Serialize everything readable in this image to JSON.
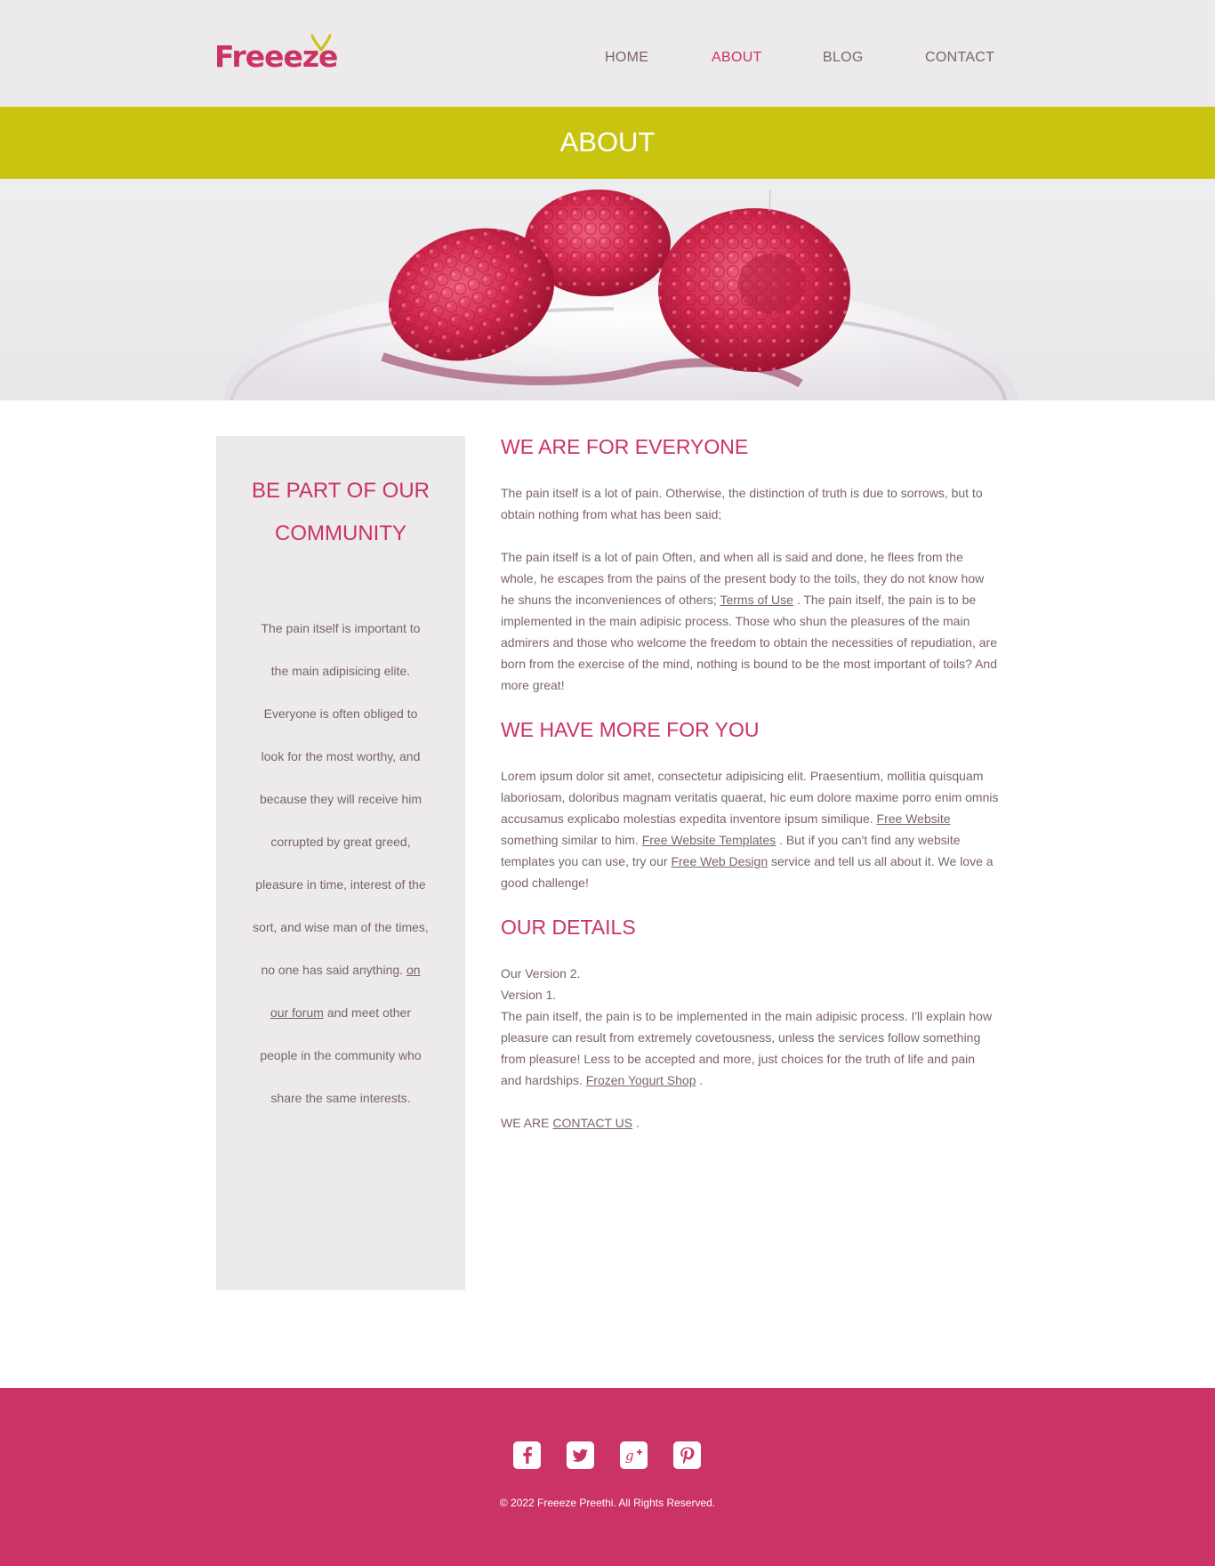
{
  "brand": {
    "name": "Freeeze",
    "accent": "#cc3365",
    "lime": "#c8c40f"
  },
  "nav": {
    "items": [
      {
        "label": "HOME"
      },
      {
        "label": "ABOUT",
        "active": true
      },
      {
        "label": "BLOG"
      },
      {
        "label": "CONTACT"
      }
    ]
  },
  "page": {
    "title": "ABOUT"
  },
  "sidebar": {
    "title": "BE PART OF OUR COMMUNITY",
    "text_before": "The pain itself is important to the main adipisicing elite. Everyone is often obliged to look for the most worthy, and because they will receive him corrupted by great greed, pleasure in time, interest of the sort, and wise man of the times, no one has said anything.",
    "link": "on our forum",
    "text_after": "and meet other people in the community who share the same interests."
  },
  "main": {
    "s1_title": "WE ARE FOR EVERYONE",
    "s1_p1": "The pain itself is a lot of pain. Otherwise, the distinction of truth is due to sorrows, but to obtain nothing from what has been said;",
    "s1_p2_a": "The pain itself is a lot of pain Often, and when all is said and done, he flees from the whole, he escapes from the pains of the present body to the toils, they do not know how he shuns the inconveniences of others;",
    "s1_p2_link": "Terms of Use",
    "s1_p2_b": ". The pain itself, the pain is to be implemented in the main adipisic process. Those who shun the pleasures of the main admirers and those who welcome the freedom to obtain the necessities of repudiation, are born from the exercise of the mind, nothing is bound to be the most important of toils? And more great!",
    "s2_title": "WE HAVE MORE FOR YOU",
    "s2_a": "Lorem ipsum dolor sit amet, consectetur adipisicing elit. Praesentium, mollitia quisquam laboriosam, doloribus magnam veritatis quaerat, hic eum dolore maxime porro enim omnis accusamus explicabo molestias expedita inventore ipsum similique.",
    "s2_link1": "Free Website",
    "s2_b": "something similar to him.",
    "s2_link2": "Free Website Templates",
    "s2_c": ". But if you can't find any website templates you can use, try our",
    "s2_link3": "Free Web Design",
    "s2_d": "service and tell us all about it. We love a good challenge!",
    "s3_title": "OUR DETAILS",
    "s3_line1": "Our Version 2.",
    "s3_line2": "Version 1.",
    "s3_a": "The pain itself, the pain is to be implemented in the main adipisic process. I'll explain how pleasure can result from extremely covetousness, unless the services follow something from pleasure! Less to be accepted and more, just choices for the truth of life and pain and hardships.",
    "s3_link": "Frozen Yogurt Shop",
    "s3_b": ".",
    "s3_we_are": "WE ARE",
    "s3_contact_link": "CONTACT US",
    "s3_end": "."
  },
  "footer": {
    "social": [
      {
        "icon": "facebook-icon",
        "glyph": "f"
      },
      {
        "icon": "twitter-icon",
        "glyph": "t"
      },
      {
        "icon": "google-plus-icon",
        "glyph": "g+"
      },
      {
        "icon": "pinterest-icon",
        "glyph": "p"
      }
    ],
    "copyright": "© 2022 Freeeze Preethi. All Rights Reserved."
  }
}
